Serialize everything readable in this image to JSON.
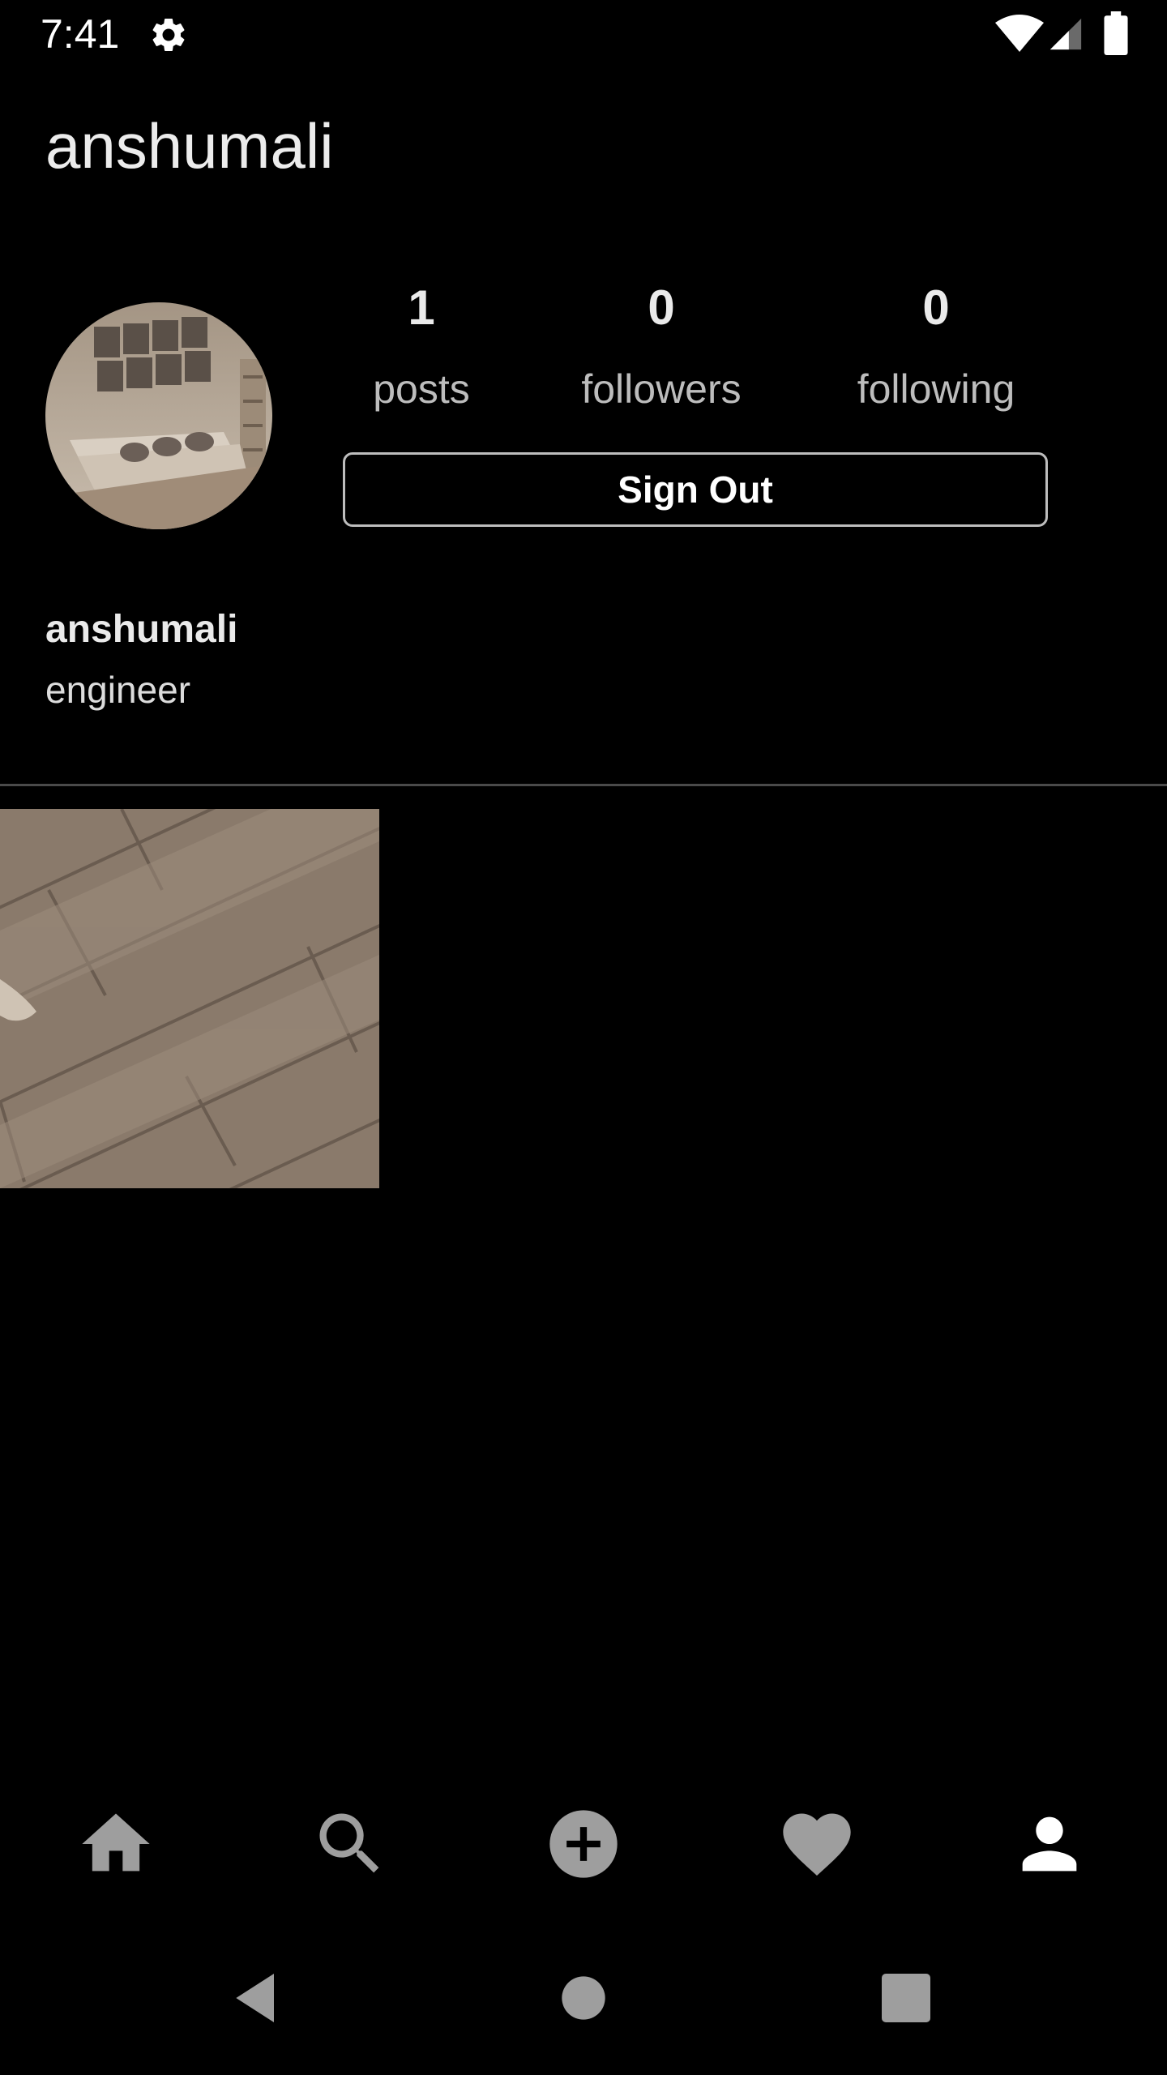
{
  "status_bar": {
    "time": "7:41",
    "icons": [
      "settings-icon",
      "wifi-icon",
      "signal-icon",
      "battery-icon"
    ]
  },
  "header": {
    "username": "anshumali"
  },
  "profile": {
    "stats": [
      {
        "value": "1",
        "label": "posts"
      },
      {
        "value": "0",
        "label": "followers"
      },
      {
        "value": "0",
        "label": "following"
      }
    ],
    "sign_out_label": "Sign Out",
    "display_name": "anshumali",
    "bio": "engineer"
  },
  "bottom_nav": {
    "items": [
      "home-icon",
      "search-icon",
      "add-post-icon",
      "activity-heart-icon",
      "profile-icon"
    ],
    "active": "profile-icon"
  },
  "system_nav": [
    "back-icon",
    "home-circle-icon",
    "recents-icon"
  ],
  "colors": {
    "background": "#000000",
    "text_primary": "#eaeaea",
    "text_secondary": "#bdbdbd",
    "nav_inactive": "#9e9e9e",
    "nav_active": "#ffffff"
  }
}
